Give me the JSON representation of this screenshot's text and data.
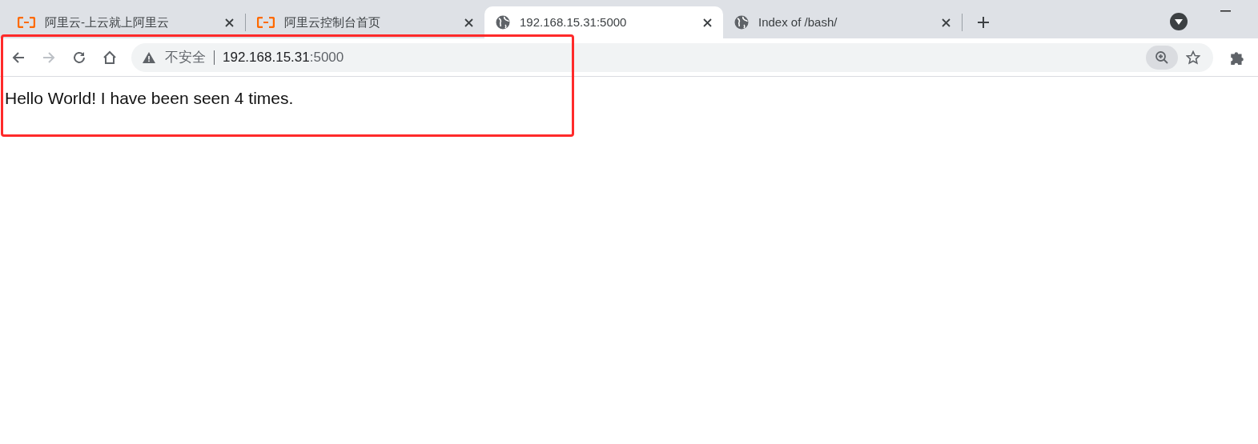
{
  "tabs": [
    {
      "title": "阿里云-上云就上阿里云",
      "kind": "branded",
      "selected": false
    },
    {
      "title": "阿里云控制台首页",
      "kind": "branded",
      "selected": false
    },
    {
      "title": "192.168.15.31:5000",
      "kind": "plain",
      "selected": true
    },
    {
      "title": "Index of /bash/",
      "kind": "plain",
      "selected": false
    }
  ],
  "address_bar": {
    "security_label": "不安全",
    "host": "192.168.15.31",
    "port": ":5000"
  },
  "page": {
    "text": "Hello World! I have been seen 4 times."
  }
}
